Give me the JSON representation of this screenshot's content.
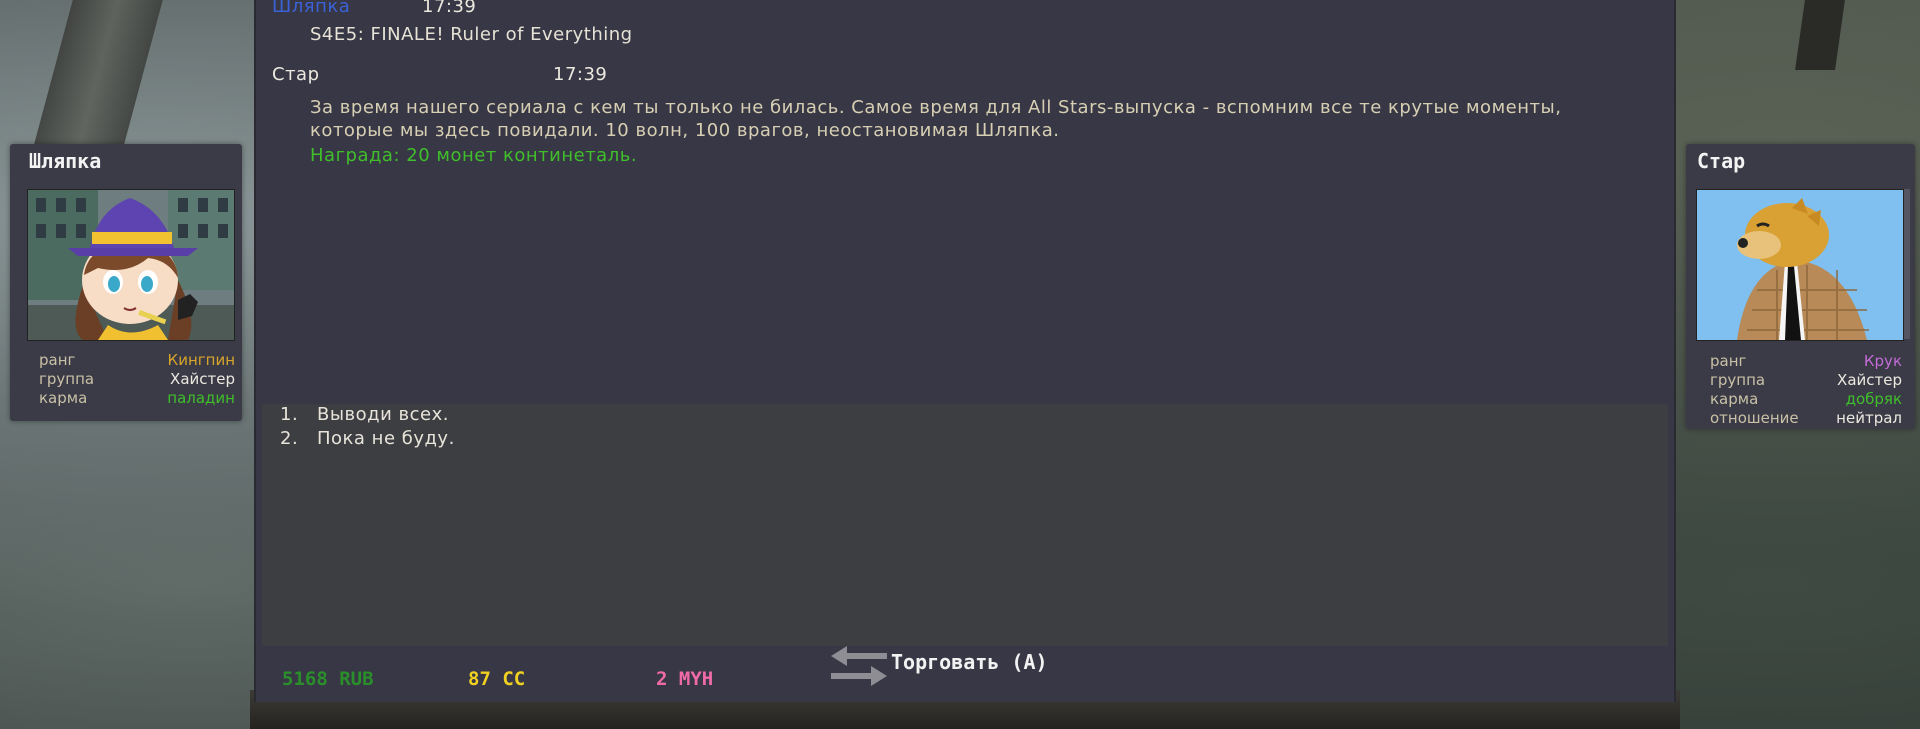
{
  "conversation": [
    {
      "speaker": "Шляпка",
      "speaker_color": "#3a63d8",
      "time": "17:39",
      "text": "S4E5: FINALE! Ruler of Everything",
      "text_color": "#e6e2d5"
    },
    {
      "speaker": "Стар",
      "speaker_color": "#ece9df",
      "time": "17:39",
      "text": "За время нашего сериала с кем ты только не билась. Самое время для All Stars-выпуска - вспомним все те крутые моменты, которые мы здесь повидали. 10 волн, 100 врагов, неостановимая Шляпка.",
      "reward": "Награда: 20 монет континеталь.",
      "reward_color": "#3fbf2a"
    }
  ],
  "answers": [
    {
      "num": "1.",
      "text": "Выводи всех."
    },
    {
      "num": "2.",
      "text": "Пока не буду."
    }
  ],
  "footer": {
    "money": "5168 RUB",
    "money_color": "#2a8f2a",
    "cc": "87 CC",
    "cc_color": "#f0d020",
    "myh": "2 MYH",
    "myh_color": "#f06aa8",
    "trade_label": "Торговать (A)"
  },
  "left_panel": {
    "name": "Шляпка",
    "stats": [
      {
        "label": "ранг",
        "value": "Кингпин",
        "color": "#d7a52a"
      },
      {
        "label": "группа",
        "value": "Хайстер",
        "color": "#ece9df"
      },
      {
        "label": "карма",
        "value": "паладин",
        "color": "#3fbf2a"
      }
    ]
  },
  "right_panel": {
    "name": "Стар",
    "stats": [
      {
        "label": "ранг",
        "value": "Крук",
        "color": "#c36bd6"
      },
      {
        "label": "группа",
        "value": "Хайстер",
        "color": "#ece9df"
      },
      {
        "label": "карма",
        "value": "добряк",
        "color": "#3fbf2a"
      },
      {
        "label": "отношение",
        "value": "нейтрал",
        "color": "#ece9df"
      }
    ]
  }
}
